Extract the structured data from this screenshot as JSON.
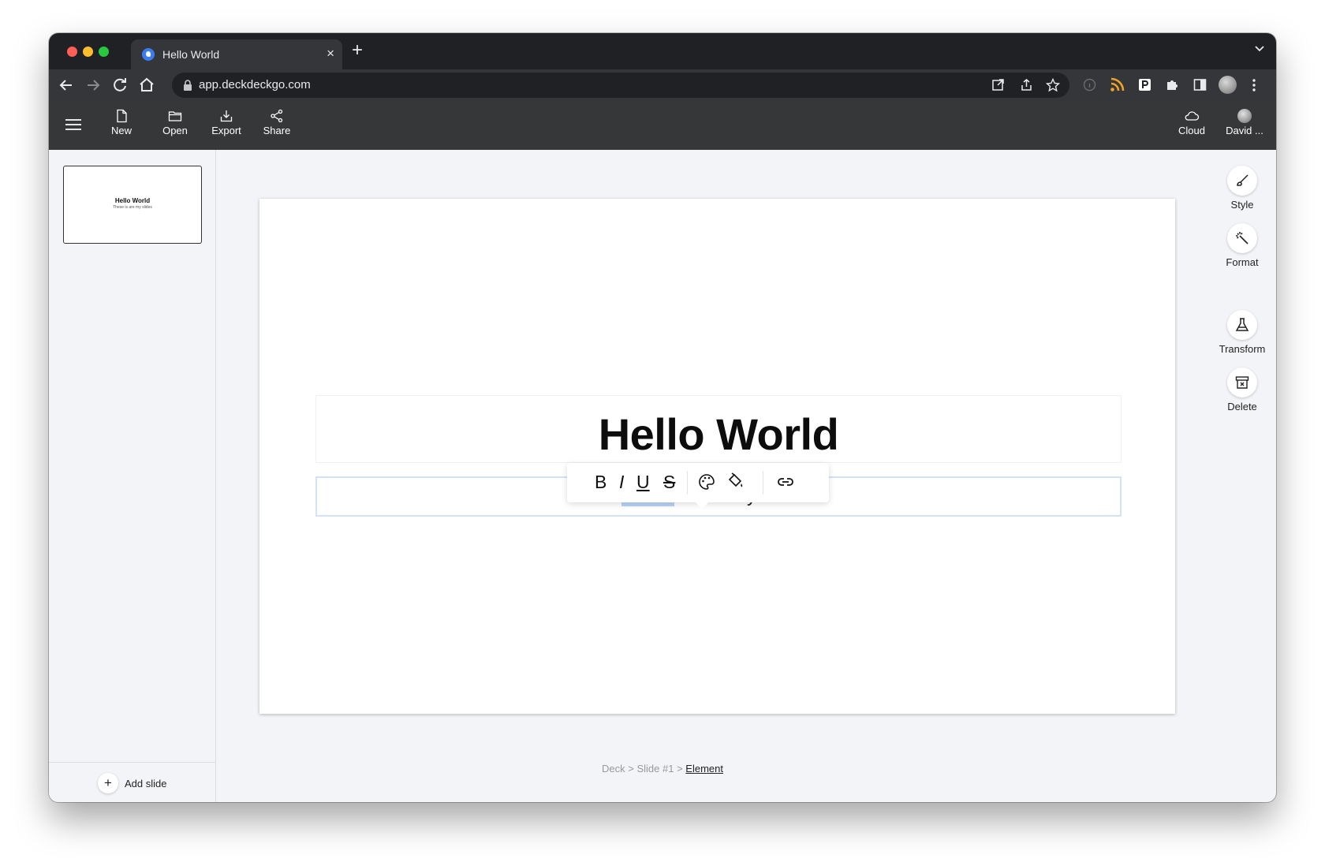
{
  "browser": {
    "tab_title": "Hello World",
    "tab_close": "×",
    "new_tab": "+",
    "url": "app.deckdeckgo.com"
  },
  "header": {
    "new_label": "New",
    "open_label": "Open",
    "export_label": "Export",
    "share_label": "Share",
    "cloud_label": "Cloud",
    "user_label": "David ..."
  },
  "sidebar": {
    "thumb_title": "Hello World",
    "thumb_subtitle": "These is are my slides",
    "add_slide_label": "Add slide",
    "add_icon": "+"
  },
  "slide": {
    "title": "Hello World",
    "subtitle_selected": "These",
    "subtitle_rest": " is are my slides."
  },
  "format_toolbar": {
    "bold": "B",
    "italic": "I",
    "underline": "U",
    "strike": "S"
  },
  "right_panel": {
    "style_label": "Style",
    "format_label": "Format",
    "transform_label": "Transform",
    "delete_label": "Delete"
  },
  "breadcrumb": {
    "deck": "Deck",
    "sep1": " > ",
    "slide": "Slide #1",
    "sep2": " > ",
    "element": "Element"
  },
  "colors": {
    "selection": "#b6d3f7",
    "app_header": "#353739",
    "workspace": "#f3f4f7"
  }
}
